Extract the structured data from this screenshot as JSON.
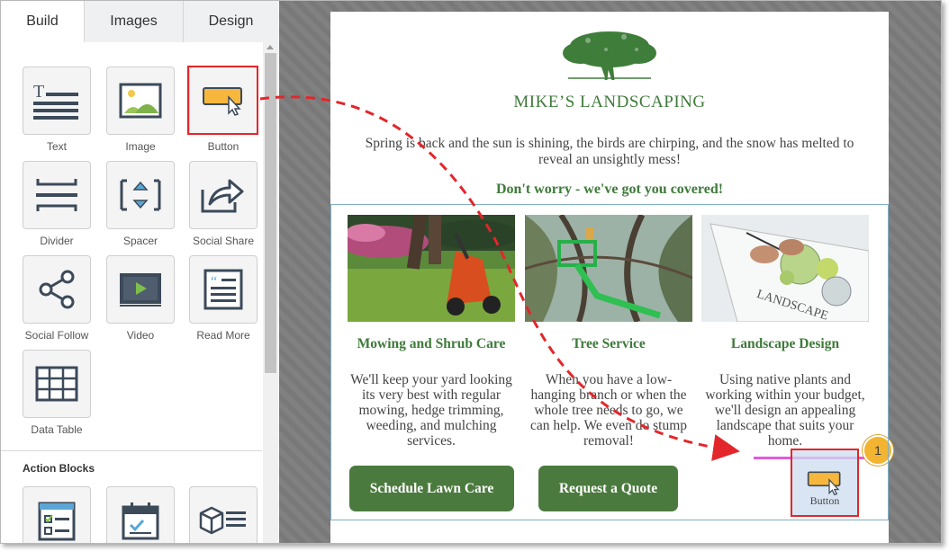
{
  "tabs": [
    {
      "label": "Build"
    },
    {
      "label": "Images"
    },
    {
      "label": "Design"
    }
  ],
  "blocks": [
    {
      "label": "Text",
      "icon": "text-icon"
    },
    {
      "label": "Image",
      "icon": "image-icon"
    },
    {
      "label": "Button",
      "icon": "button-icon"
    },
    {
      "label": "Divider",
      "icon": "divider-icon"
    },
    {
      "label": "Spacer",
      "icon": "spacer-icon"
    },
    {
      "label": "Social Share",
      "icon": "social-share-icon"
    },
    {
      "label": "Social Follow",
      "icon": "social-follow-icon"
    },
    {
      "label": "Video",
      "icon": "video-icon"
    },
    {
      "label": "Read More",
      "icon": "read-more-icon"
    },
    {
      "label": "Data Table",
      "icon": "data-table-icon"
    }
  ],
  "action_blocks": {
    "title": "Action Blocks",
    "icons": [
      "survey-icon",
      "calendar-icon",
      "product-icon"
    ]
  },
  "email": {
    "brand": "MIKE’S LANDSCAPING",
    "logo_icon": "tree-logo-icon",
    "intro": "Spring is back and the sun is shining, the birds are chirping, and the snow has melted to reveal an unsightly mess!",
    "tagline": "Don't worry - we've got you covered!",
    "columns": [
      {
        "title": "Mowing and Shrub Care",
        "text": "We'll keep your yard looking its very best with regular mowing, hedge trimming, weeding, and mulching services.",
        "button": "Schedule Lawn Care"
      },
      {
        "title": "Tree Service",
        "text": "When you have a low-hanging branch or when the whole tree needs to go, we can help. We even do stump removal!",
        "button": "Request a Quote"
      },
      {
        "title": "Landscape Design",
        "text": "Using native plants and working within your budget, we'll design an appealing landscape that suits your home.",
        "sketch_text": "LANDSCAPE"
      }
    ],
    "drop_label": "Button",
    "step_badge": "1"
  },
  "colors": {
    "green": "#3e7a3a",
    "button_green": "#4b7a3e",
    "highlight_red": "#e3262b",
    "drop_line": "#e05be0",
    "badge": "#f2b431"
  }
}
